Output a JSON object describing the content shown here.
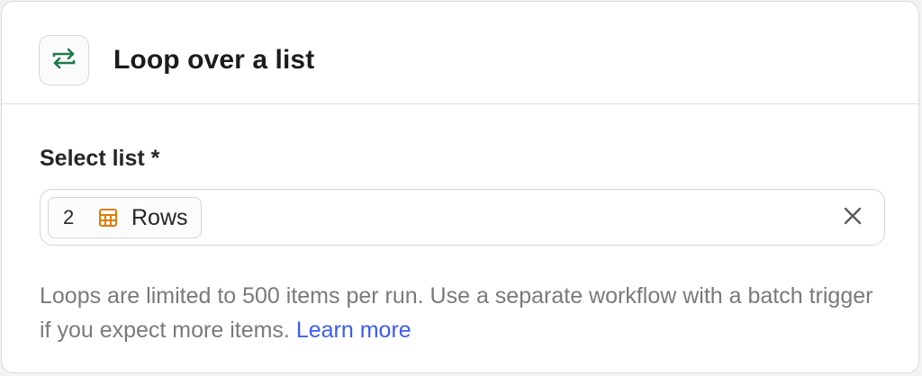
{
  "header": {
    "title": "Loop over a list",
    "icon": "loop-arrows-icon"
  },
  "field": {
    "label": "Select list *",
    "selected": {
      "index": "2",
      "icon": "table-icon",
      "label": "Rows"
    },
    "clear_icon": "close-icon"
  },
  "help": {
    "text": "Loops are limited to 500 items per run. Use a separate workflow with a batch trigger if you expect more items. ",
    "link_text": "Learn more"
  },
  "colors": {
    "loop_icon": "#1f7a4d",
    "table_icon": "#e07b00",
    "link": "#3d5cf0"
  }
}
